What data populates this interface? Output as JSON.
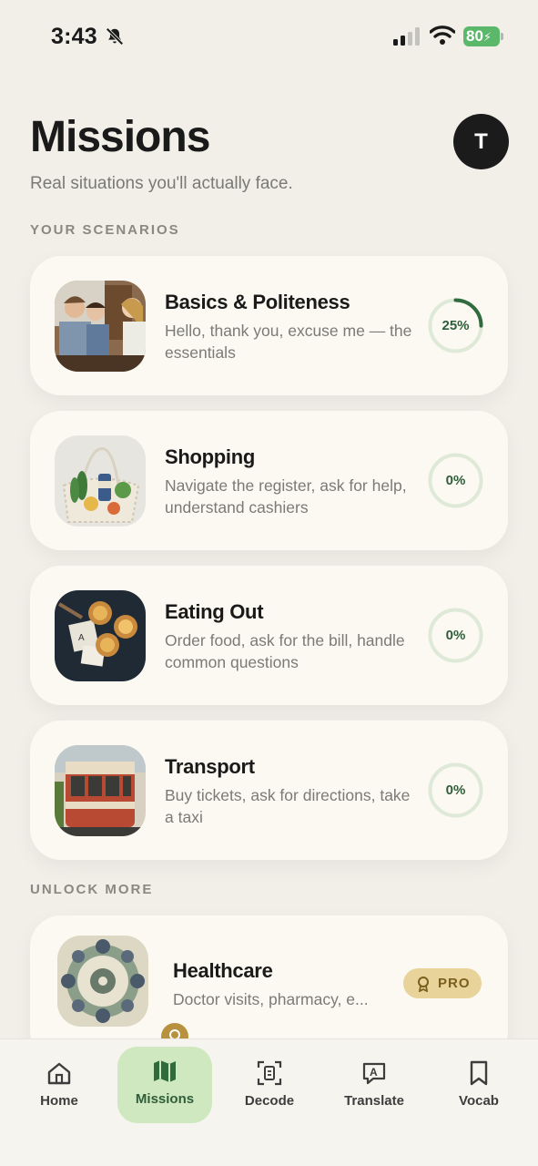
{
  "status_bar": {
    "time": "3:43",
    "battery": "80"
  },
  "header": {
    "title": "Missions",
    "avatar_initial": "T",
    "subtitle": "Real situations you'll actually face."
  },
  "sections": {
    "scenarios_label": "YOUR SCENARIOS",
    "unlock_label": "UNLOCK MORE"
  },
  "scenarios": [
    {
      "title": "Basics & Politeness",
      "description": "Hello, thank you, excuse me — the essentials",
      "progress_label": "25%",
      "progress": 0.25
    },
    {
      "title": "Shopping",
      "description": "Navigate the register, ask for help, understand cashiers",
      "progress_label": "0%",
      "progress": 0
    },
    {
      "title": "Eating Out",
      "description": "Order food, ask for the bill, handle common questions",
      "progress_label": "0%",
      "progress": 0
    },
    {
      "title": "Transport",
      "description": "Buy tickets, ask for directions, take a taxi",
      "progress_label": "0%",
      "progress": 0
    }
  ],
  "locked": [
    {
      "title": "Healthcare",
      "description": "Doctor visits, pharmacy, e...",
      "badge": "PRO"
    }
  ],
  "tabs": [
    {
      "label": "Home",
      "icon": "home-icon"
    },
    {
      "label": "Missions",
      "icon": "map-icon",
      "active": true
    },
    {
      "label": "Decode",
      "icon": "decode-icon"
    },
    {
      "label": "Translate",
      "icon": "translate-icon"
    },
    {
      "label": "Vocab",
      "icon": "bookmark-icon"
    }
  ],
  "colors": {
    "background": "#f1efe8",
    "card": "#fbf9f2",
    "accent_green": "#2f6b3c",
    "progress_track": "#dfe9d8",
    "pro_gold": "#e8d39a",
    "active_tab": "#cfe8bf"
  }
}
